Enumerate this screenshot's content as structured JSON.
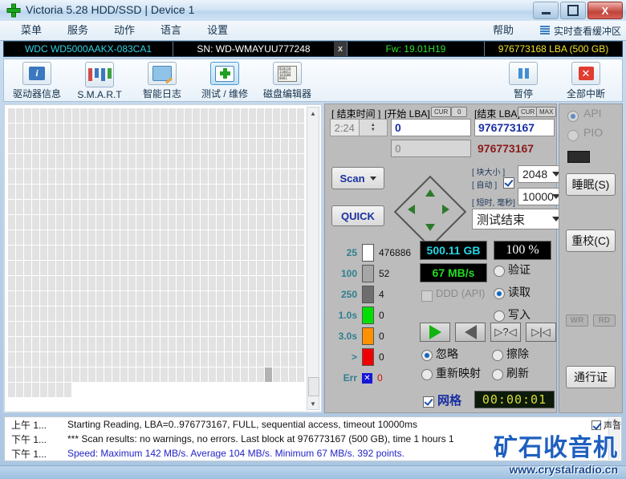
{
  "window": {
    "title": "Victoria 5.28 HDD/SSD | Device 1",
    "app_icon": "green-cross-icon",
    "minimize": "minimize-icon",
    "maximize": "maximize-icon",
    "close": "X"
  },
  "menu": {
    "items": [
      {
        "label": "菜单"
      },
      {
        "label": "服务"
      },
      {
        "label": "动作"
      },
      {
        "label": "语言"
      },
      {
        "label": "设置"
      }
    ],
    "help": "帮助",
    "realtime_buffer": "实时查看缓冲区"
  },
  "device": {
    "model": "WDC WD5000AAKX-083CA1",
    "serial": "SN: WD-WMAYUU777248",
    "x_button": "x",
    "firmware": "Fw: 19.01H19",
    "capacity": "976773168 LBA (500 GB)"
  },
  "toolbar": {
    "buttons": [
      {
        "label": "驱动器信息",
        "icon": "info-icon"
      },
      {
        "label": "S.M.A.R.T",
        "icon": "bars-icon"
      },
      {
        "label": "智能日志",
        "icon": "folder-pencil-icon"
      },
      {
        "label": "测试 / 维修",
        "icon": "first-aid-kit-icon"
      },
      {
        "label": "磁盘编辑器",
        "icon": "binary-file-icon"
      }
    ],
    "pause": {
      "label": "暂停",
      "icon": "pause-icon"
    },
    "abort": {
      "label": "全部中断",
      "icon": "red-x-icon"
    }
  },
  "scan_panel": {
    "end_time_label": "[ 结束时间 ]",
    "end_time_value": "2:24",
    "start_lba_label": "[开始 LBA]",
    "start_lba_cur": "CUR",
    "start_lba_zero": "0",
    "start_lba_value": "0",
    "start_lba_value2": "0",
    "end_lba_label": "[结束 LBA]",
    "end_lba_cur": "CUR",
    "end_lba_max": "MAX",
    "end_lba_value": "976773167",
    "end_lba_value2": "976773167",
    "scan_button": "Scan",
    "quick_button": "QUICK",
    "block_size_label": "[ 块大小 ]",
    "auto_label": "[ 自动 ]",
    "auto_checked": true,
    "block_size_value": "2048",
    "timeout_label": "[ 短时, 毫秒]",
    "timeout_value": "10000",
    "status_select": "测试结束"
  },
  "legend": {
    "rows": [
      {
        "name": "25",
        "color": "#ffffff",
        "count": "476886"
      },
      {
        "name": "100",
        "color": "#a6a6a6",
        "count": "52"
      },
      {
        "name": "250",
        "color": "#6e6e6e",
        "count": "4"
      },
      {
        "name": "1.0s",
        "color": "#00e000",
        "count": "0"
      },
      {
        "name": "3.0s",
        "color": "#ff9000",
        "count": "0"
      },
      {
        "name": ">",
        "color": "#f00000",
        "count": "0"
      }
    ],
    "err_label": "Err",
    "err_icon": "blue-x-icon",
    "err_count": "0"
  },
  "stats": {
    "capacity_lcd": "500.11 GB",
    "capacity_color": "#24d6e6",
    "percent_lcd": "100   %",
    "percent_color": "#ffffff",
    "speed_lcd": "67 MB/s",
    "speed_color": "#23dc23",
    "ddd_label": "DDD (API)",
    "ddd_checked": false,
    "modes": [
      {
        "label": "验证",
        "selected": false
      },
      {
        "label": "读取",
        "selected": true
      },
      {
        "label": "写入",
        "selected": false
      }
    ]
  },
  "playback": {
    "buttons": [
      {
        "icon": "play-forward-icon",
        "label": "▶"
      },
      {
        "icon": "play-backward-icon",
        "label": "◀"
      },
      {
        "icon": "step-question-icon",
        "label": "▷?◁"
      },
      {
        "icon": "skip-icon",
        "label": "▷|◁"
      }
    ]
  },
  "actions": {
    "options": [
      {
        "label": "忽略",
        "selected": true
      },
      {
        "label": "擦除",
        "selected": false
      },
      {
        "label": "重新映射",
        "selected": false
      },
      {
        "label": "刷新",
        "selected": false
      }
    ],
    "grid_label": "网格",
    "grid_checked": true,
    "timer": "00:00:01"
  },
  "right_column": {
    "api_label": "API",
    "api_selected": true,
    "pio_label": "PIO",
    "pio_selected": false,
    "sleep_button": "睡眠(S)",
    "recalibrate_button": "重校(C)",
    "wr_label": "WR",
    "rd_label": "RD",
    "passport_button": "通行证"
  },
  "log": {
    "rows": [
      {
        "time": "上午 1...",
        "message": "Starting Reading, LBA=0..976773167, FULL, sequential access, timeout 10000ms",
        "color": "black"
      },
      {
        "time": "下午 1...",
        "message": "*** Scan results: no warnings, no errors. Last block at 976773167 (500 GB), time 1 hours 1",
        "color": "black"
      },
      {
        "time": "下午 1...",
        "message": "Speed: Maximum 142 MB/s. Average 104 MB/s. Minimum 67 MB/s. 392 points.",
        "color": "blue"
      }
    ],
    "sound_label": "声音",
    "sound_checked": true
  },
  "watermark": {
    "top": "矿石收音机",
    "bottom": "www.crystalradio.cn"
  },
  "map": {
    "columns": 36,
    "full_rows": 18,
    "last_row_cells": 26,
    "dark_cell_index": 13
  }
}
